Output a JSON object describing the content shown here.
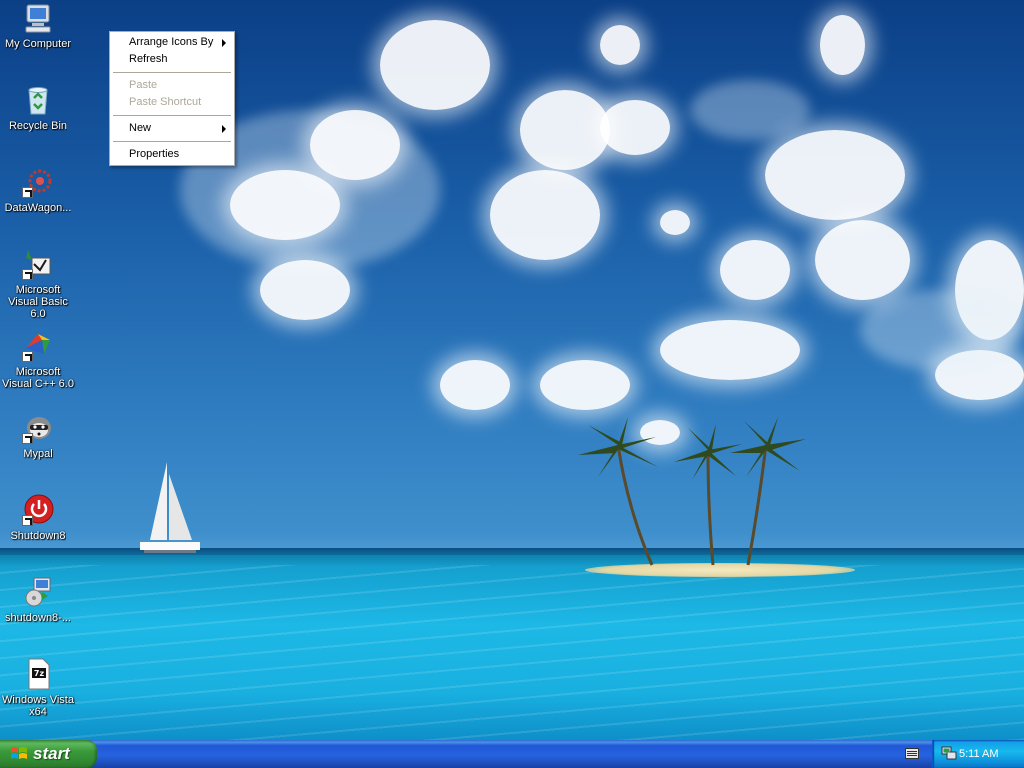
{
  "desktop": {
    "icons": [
      {
        "label": "My Computer",
        "icon": "my-computer-icon"
      },
      {
        "label": "Recycle Bin",
        "icon": "recycle-bin-icon"
      },
      {
        "label": "DataWagon...",
        "icon": "datawagon-icon"
      },
      {
        "label": "Microsoft Visual Basic 6.0",
        "icon": "visual-basic-icon"
      },
      {
        "label": "Microsoft Visual C++ 6.0",
        "icon": "visual-cpp-icon"
      },
      {
        "label": "Mypal",
        "icon": "mypal-icon"
      },
      {
        "label": "Shutdown8",
        "icon": "shutdown-icon"
      },
      {
        "label": "shutdown8-...",
        "icon": "installer-icon"
      },
      {
        "label": "Windows Vista x64",
        "icon": "7z-archive-icon"
      }
    ]
  },
  "context_menu": {
    "items": [
      {
        "label": "Arrange Icons By",
        "submenu": true,
        "enabled": true
      },
      {
        "label": "Refresh",
        "submenu": false,
        "enabled": true
      },
      {
        "label": "Paste",
        "submenu": false,
        "enabled": false
      },
      {
        "label": "Paste Shortcut",
        "submenu": false,
        "enabled": false
      },
      {
        "label": "New",
        "submenu": true,
        "enabled": true
      },
      {
        "label": "Properties",
        "submenu": false,
        "enabled": true
      }
    ]
  },
  "taskbar": {
    "start_label": "start",
    "clock": "5:11 AM"
  },
  "colors": {
    "taskbar_blue": "#245edb",
    "start_green": "#3a9a3a",
    "tray_blue": "#0f9be0"
  }
}
